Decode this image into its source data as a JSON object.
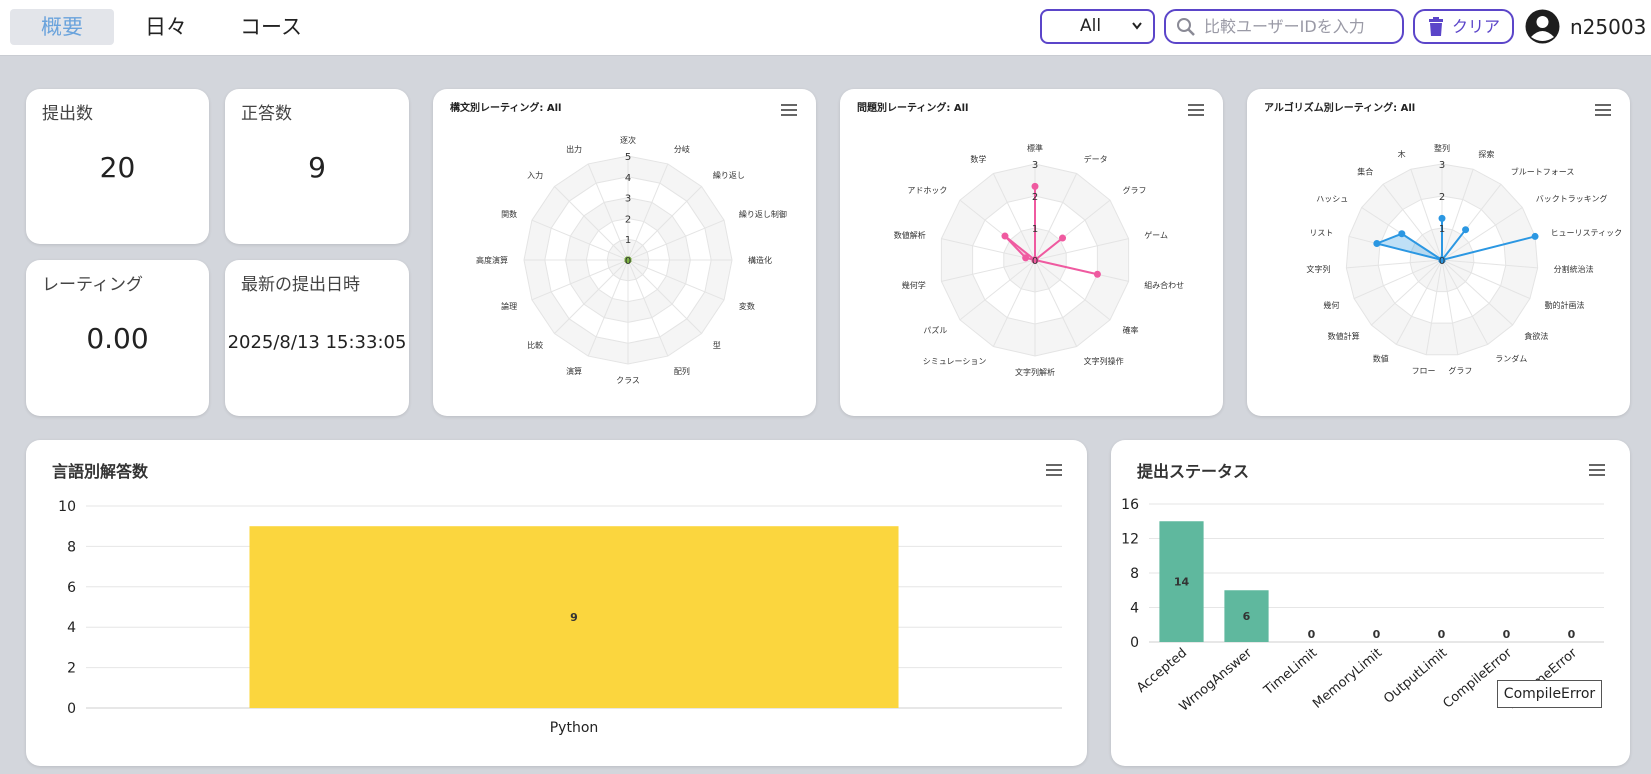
{
  "nav": {
    "tabs": [
      {
        "label": "概要"
      },
      {
        "label": "日々"
      },
      {
        "label": "コース"
      }
    ]
  },
  "filter": {
    "selected": "All",
    "search_placeholder": "比較ユーザーIDを入力",
    "clear_label": "クリア"
  },
  "user": {
    "name": "n25003"
  },
  "stats": {
    "submissions": {
      "label": "提出数",
      "value": "20"
    },
    "correct": {
      "label": "正答数",
      "value": "9"
    },
    "rating": {
      "label": "レーティング",
      "value": "0.00"
    },
    "latest": {
      "label": "最新の提出日時",
      "value": "2025/8/13 15:33:05"
    }
  },
  "colors": {
    "accent": "#5b45c9",
    "pink": "#ef5aa0",
    "blue": "#2b97e2",
    "yellow": "#fbd63e",
    "teal": "#5fb89e"
  },
  "charts": {
    "syntax": {
      "title": "構文別レーティング: All",
      "chart_data": {
        "type": "radar",
        "categories": [
          "逐次",
          "分岐",
          "繰り返し",
          "繰り返し制御",
          "構造化",
          "変数",
          "型",
          "配列",
          "クラス",
          "演算",
          "比較",
          "論理",
          "高度演算",
          "関数",
          "入力",
          "出力"
        ],
        "rlim": [
          0,
          5
        ],
        "ticks": [
          "0",
          "1",
          "2",
          "3",
          "4",
          "5"
        ],
        "values": [
          0,
          0,
          0,
          0,
          0,
          0,
          0,
          0,
          0,
          0,
          0,
          0,
          0,
          0,
          0,
          0
        ],
        "color": "#7cb342"
      }
    },
    "problem": {
      "title": "問題別レーティング: All",
      "chart_data": {
        "type": "radar",
        "categories": [
          "標準",
          "データ",
          "グラフ",
          "ゲーム",
          "組み合わせ",
          "確率",
          "文字列操作",
          "文字列解析",
          "シミュレーション",
          "パズル",
          "幾何学",
          "数値解析",
          "アドホック",
          "数学"
        ],
        "rlim": [
          0,
          3
        ],
        "ticks": [
          "0",
          "1",
          "2",
          "3"
        ],
        "values": [
          2.3,
          0,
          1.1,
          0,
          2.0,
          0,
          0,
          0,
          0,
          0,
          0,
          0.3,
          1.2,
          0
        ],
        "color": "#ef5aa0"
      }
    },
    "algorithm": {
      "title": "アルゴリズム別レーティング: All",
      "chart_data": {
        "type": "radar",
        "categories": [
          "整列",
          "探索",
          "ブルートフォース",
          "バックトラッキング",
          "ヒューリスティック",
          "分割統治法",
          "動的計画法",
          "貪欲法",
          "ランダム",
          "グラフ",
          "フロー",
          "数値",
          "数値計算",
          "幾何",
          "文字列",
          "リスト",
          "ハッシュ",
          "集合",
          "木"
        ],
        "rlim": [
          0,
          3
        ],
        "ticks": [
          "0",
          "1",
          "2",
          "3"
        ],
        "values": [
          1.3,
          0,
          1.2,
          0,
          3.0,
          0,
          0,
          0,
          0,
          0,
          0,
          0,
          0,
          0,
          0,
          2.1,
          1.5,
          0,
          0
        ],
        "color": "#2b97e2"
      }
    },
    "language": {
      "title": "言語別解答数",
      "chart_data": {
        "type": "bar",
        "categories": [
          "Python"
        ],
        "values": [
          9
        ],
        "ylim": [
          0,
          10
        ],
        "yticks": [
          "0",
          "2",
          "4",
          "6",
          "8",
          "10"
        ],
        "labels": [
          "9"
        ],
        "color": "#fbd63e"
      }
    },
    "status": {
      "title": "提出ステータス",
      "chart_data": {
        "type": "bar",
        "categories": [
          "Accepted",
          "WrnogAnswer",
          "TimeLimit",
          "MemoryLimit",
          "OutputLimit",
          "CompileError",
          "RuntimeError"
        ],
        "values": [
          14,
          6,
          0,
          0,
          0,
          0,
          0
        ],
        "ylim": [
          0,
          16
        ],
        "yticks": [
          "0",
          "4",
          "8",
          "12",
          "16"
        ],
        "labels": [
          "14",
          "6",
          "0",
          "0",
          "0",
          "0",
          "0"
        ],
        "color": "#5fb89e"
      }
    }
  },
  "tooltip": {
    "text": "CompileError"
  }
}
